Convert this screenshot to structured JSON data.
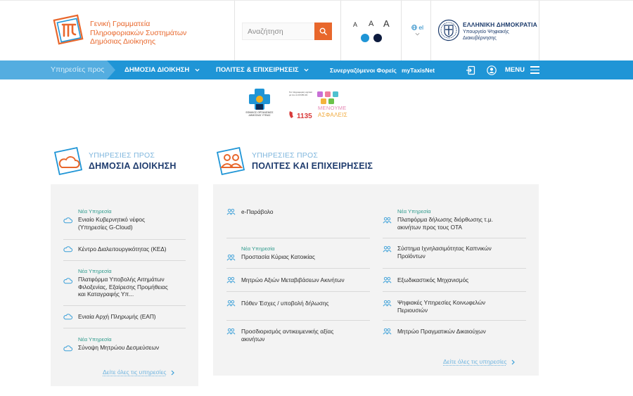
{
  "header": {
    "logo_lines": [
      "Γενική Γραμματεία",
      "Πληροφοριακών Συστημάτων",
      "Δημόσιας Διοίκησης"
    ],
    "search": {
      "placeholder": "Αναζήτηση"
    },
    "font_size_labels": [
      "A",
      "A",
      "A"
    ],
    "contrast_colors": [
      "#1f95d6",
      "#0d1b3e"
    ],
    "language": "el",
    "gov": {
      "title": "ΕΛΛΗΝΙΚΗ ΔΗΜΟΚΡΑΤΙΑ",
      "subtitle_lines": [
        "Υπουργείο Ψηφιακής",
        "Διακυβέρνησης"
      ]
    }
  },
  "nav": {
    "services_for": "Υπηρεσίες προς",
    "public_admin": "ΔΗΜΟΣΙΑ ΔΙΟΙΚΗΣΗ",
    "citizens": "ΠΟΛΙΤΕΣ & ΕΠΙΧΕΙΡΗΣΕΙΣ",
    "partners": "Συνεργαζόμενοι Φορείς",
    "mytaxisnet": "myTaxisNet",
    "menu": "MENU"
  },
  "banners": {
    "eody_text": "ΕΘΝΙΚΟΣ ΟΡΓΑΝΙΣΜΟΣ ΔΗΜΟΣΙΑΣ ΥΓΕΙΑΣ",
    "phone": "1135",
    "word1": "ΜΕΝΟΥΜΕ",
    "word2": "ΑΣΦΑΛΕΙΣ",
    "small_text": "Για πληροφορίες σχετικά με τον ιό COVID-19"
  },
  "left_section": {
    "pre": "ΥΠΗΡΕΣΙΕΣ ΠΡΟΣ",
    "title": "ΔΗΜΟΣΙΑ ΔΙΟΙΚΗΣΗ",
    "new_label": "Νέα Υπηρεσία",
    "items": [
      {
        "new": true,
        "lines": [
          "Ενιαίο Κυβερνητικό νέφος",
          "(Υπηρεσίες G-Cloud)"
        ]
      },
      {
        "new": false,
        "lines": [
          "Κέντρο Διαλειτουργικότητας (ΚΕΔ)"
        ]
      },
      {
        "new": true,
        "lines": [
          "Πλατφόρμα Υποβολής Αιτημάτων",
          "Φιλοξενίας, Εξαίρεσης Προμήθειας",
          "και Καταγραφής Υπ..."
        ]
      },
      {
        "new": false,
        "lines": [
          "Ενιαία Αρχή Πληρωμής (ΕΑΠ)"
        ]
      },
      {
        "new": true,
        "lines": [
          "Σύνοψη Μητρώου Δεσμεύσεων"
        ]
      }
    ],
    "see_all": "Δείτε όλες τις υπηρεσίες"
  },
  "right_section": {
    "pre": "ΥΠΗΡΕΣΙΕΣ ΠΡΟΣ",
    "title": "ΠΟΛΙΤΕΣ ΚΑΙ ΕΠΙΧΕΙΡΗΣΕΙΣ",
    "new_label": "Νέα Υπηρεσία",
    "col1": [
      {
        "new": false,
        "lines": [
          "e-Παράβολο"
        ]
      },
      {
        "new": true,
        "lines": [
          "Προστασία Κύριας Κατοικίας"
        ]
      },
      {
        "new": false,
        "lines": [
          "Μητρώο Αξιών Μεταβιβάσεων Ακινήτων"
        ]
      },
      {
        "new": false,
        "lines": [
          "Πόθεν Έσχες / υποβολή δήλωσης"
        ]
      },
      {
        "new": false,
        "lines": [
          "Προσδιορισμός αντικειμενικής αξίας",
          "ακινήτων"
        ]
      }
    ],
    "col2": [
      {
        "new": true,
        "lines": [
          "Πλατφόρμα δήλωσης διόρθωσης τ.μ.",
          "ακινήτων προς τους ΟΤΑ"
        ]
      },
      {
        "new": false,
        "lines": [
          "Σύστημα Ιχνηλασιμότητας Καπνικών",
          "Προϊόντων"
        ]
      },
      {
        "new": false,
        "lines": [
          "Εξωδικαστικός Μηχανισμός"
        ]
      },
      {
        "new": false,
        "lines": [
          "Ψηφιακές Υπηρεσίες Κοινωφελών",
          "Περιουσιών"
        ]
      },
      {
        "new": false,
        "lines": [
          "Μητρώο Πραγματικών Δικαιούχων"
        ]
      }
    ],
    "see_all": "Δείτε όλες τις υπηρεσίες"
  }
}
